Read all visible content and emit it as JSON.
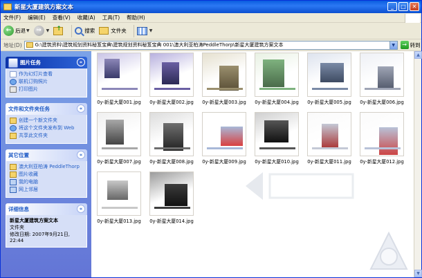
{
  "window": {
    "title": "新星大厦建筑方案文本"
  },
  "menu": [
    "文件(F)",
    "编辑(E)",
    "查看(V)",
    "收藏(A)",
    "工具(T)",
    "帮助(H)"
  ],
  "toolbar": {
    "back": "后退",
    "search": "搜索",
    "folders": "文件夹"
  },
  "address": {
    "label": "地址(D)",
    "value": "G:\\建筑资料\\建筑规划资料秘笈宝典\\建筑规划资料秘笈宝典 001\\澳大利亚柏涛PeddleThorp\\新星大厦建筑方案文本",
    "go": "转到"
  },
  "sidebar": {
    "picture_tasks": {
      "title": "图片任务",
      "items": [
        "作为幻灯片查看",
        "联机订购照片",
        "打印图片"
      ]
    },
    "file_tasks": {
      "title": "文件和文件夹任务",
      "items": [
        "创建一个新文件夹",
        "将这个文件夹发布到 Web",
        "共享此文件夹"
      ]
    },
    "other_places": {
      "title": "其它位置",
      "items": [
        "澳大利亚柏涛 PeddleThorp",
        "图片收藏",
        "我的电脑",
        "网上邻居"
      ]
    },
    "details": {
      "title": "详细信息",
      "name": "新星大厦建筑方案文本",
      "type": "文件夹",
      "modified": "修改日期: 2007年9月21日, 22:44"
    }
  },
  "files": [
    "0y-新星大厦001.jpg",
    "0y-新星大厦002.jpg",
    "0y-新星大厦003.jpg",
    "0y-新星大厦004.jpg",
    "0y-新星大厦005.jpg",
    "0y-新星大厦006.jpg",
    "0y-新星大厦007.jpg",
    "0y-新星大厦008.jpg",
    "0y-新星大厦009.jpg",
    "0y-新星大厦010.jpg",
    "0y-新星大厦011.jpg",
    "0y-新星大厦012.jpg",
    "0y-新星大厦013.jpg",
    "0y-新星大厦014.jpg"
  ]
}
